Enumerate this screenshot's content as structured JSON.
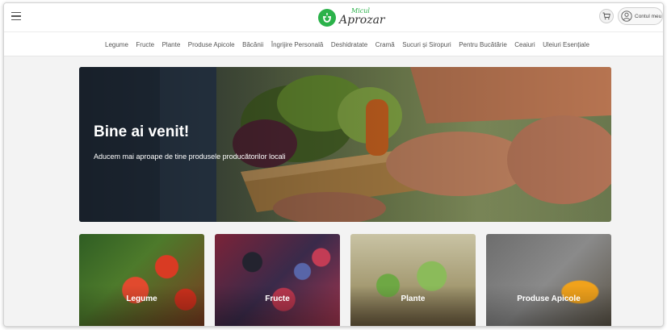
{
  "header": {
    "logo_small": "Micul",
    "logo_big": "Aprozar",
    "account_label": "Contul meu"
  },
  "categories_nav": [
    "Legume",
    "Fructe",
    "Plante",
    "Produse Apicole",
    "Băcănii",
    "Îngrijire Personală",
    "Deshidratate",
    "Cramă",
    "Sucuri și Siropuri",
    "Pentru Bucătărie",
    "Ceaiuri",
    "Uleiuri Esențiale"
  ],
  "hero": {
    "title": "Bine ai venit!",
    "subtitle": "Aducem mai aproape de tine produsele producătorilor locali"
  },
  "cards": [
    {
      "label": "Legume"
    },
    {
      "label": "Fructe"
    },
    {
      "label": "Plante"
    },
    {
      "label": "Produse Apicole"
    }
  ],
  "colors": {
    "brand_green": "#2bb24a",
    "text_gray": "#555555"
  },
  "icons": [
    "hamburger-menu-icon",
    "cart-icon",
    "user-icon",
    "logo-icon"
  ]
}
